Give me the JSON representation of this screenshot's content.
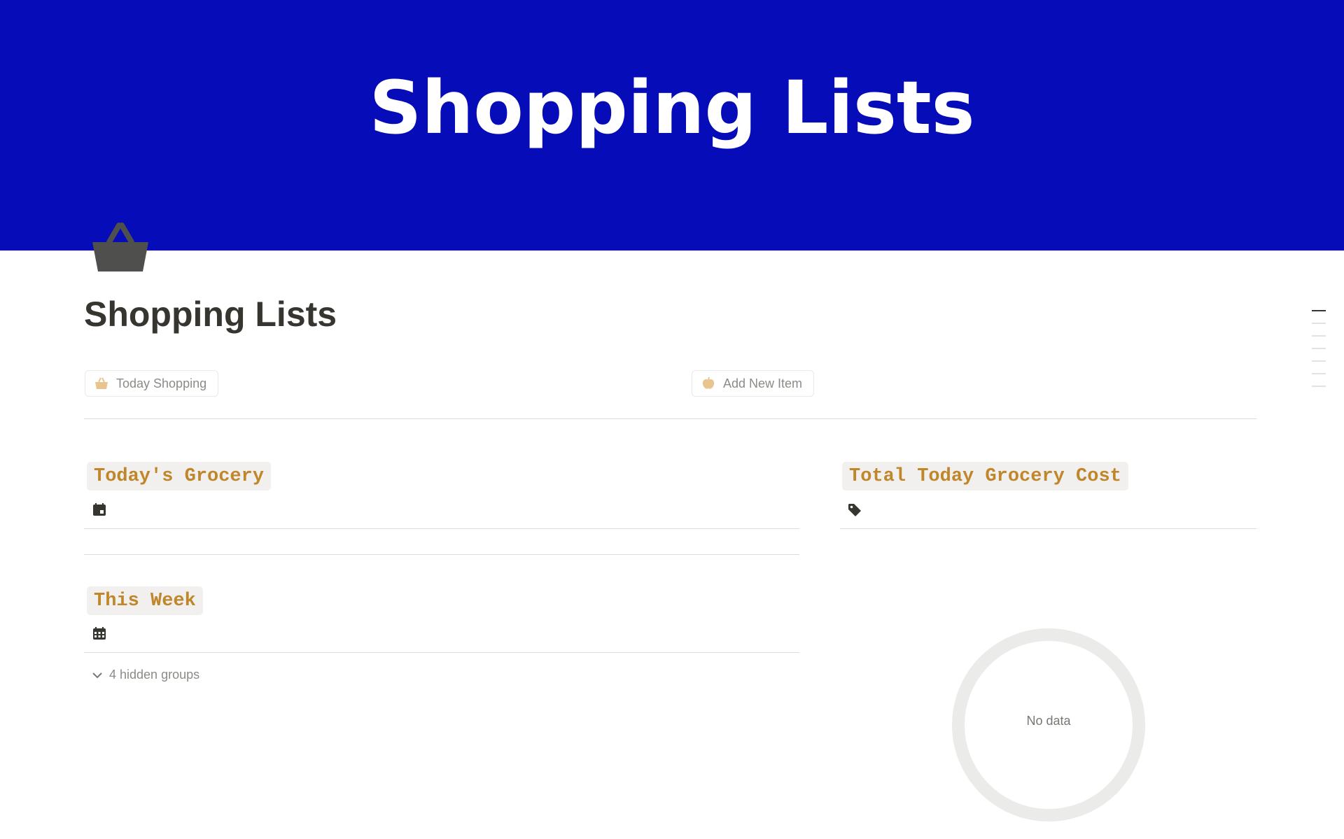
{
  "cover": {
    "title": "Shopping Lists",
    "background": "#050cb8"
  },
  "page": {
    "icon": "basket-icon",
    "title": "Shopping Lists"
  },
  "buttons": [
    {
      "label": "Today Shopping",
      "icon": "basket-icon"
    },
    {
      "label": "Add New Item",
      "icon": "apple-icon"
    }
  ],
  "sections": {
    "todays_grocery": {
      "title": "Today's Grocery",
      "icon": "calendar-day-icon"
    },
    "this_week": {
      "title": "This Week",
      "icon": "calendar-icon",
      "hidden_groups": "4 hidden groups"
    },
    "total_cost": {
      "title": "Total Today Grocery Cost",
      "icon": "tag-icon",
      "chart_empty_text": "No data"
    }
  },
  "colors": {
    "heading_text": "#c0862a",
    "heading_bg": "#f1f0ee"
  }
}
